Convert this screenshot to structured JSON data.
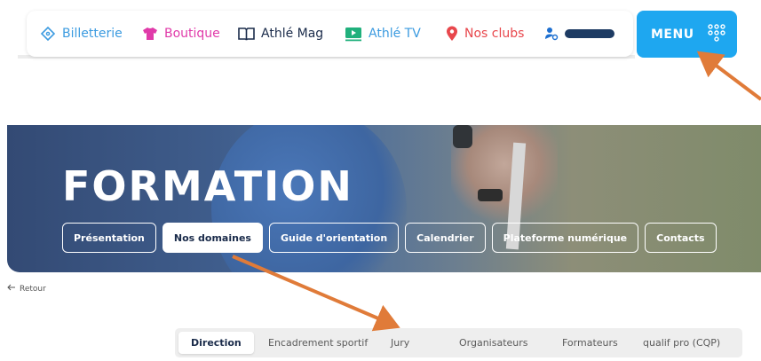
{
  "topbar": {
    "items": [
      {
        "label": "Billetterie",
        "icon": "ticket-icon",
        "color": "#3c9be0"
      },
      {
        "label": "Boutique",
        "icon": "tshirt-icon",
        "color": "#e03aa9"
      },
      {
        "label": "Athlé Mag",
        "icon": "book-icon",
        "color": "#1a2b4a"
      },
      {
        "label": "Athlé TV",
        "icon": "tv-icon",
        "color": "#20b07c"
      },
      {
        "label": "Nos clubs",
        "icon": "map-pin-icon",
        "color": "#e8474c"
      }
    ],
    "user_icon": "user-icon"
  },
  "menu": {
    "label": "MENU",
    "icon": "dots-grid-icon",
    "color": "#1ea7f0"
  },
  "hero": {
    "title": "FORMATION",
    "tabs": [
      {
        "label": "Présentation",
        "active": false
      },
      {
        "label": "Nos domaines",
        "active": true
      },
      {
        "label": "Guide d'orientation",
        "active": false
      },
      {
        "label": "Calendrier",
        "active": false
      },
      {
        "label": "Plateforme numérique",
        "active": false
      },
      {
        "label": "Contacts",
        "active": false
      }
    ]
  },
  "back": {
    "label": "Retour",
    "icon": "arrow-left-icon"
  },
  "subtabs": [
    {
      "label": "Direction",
      "active": true
    },
    {
      "label": "Encadrement sportif",
      "active": false
    },
    {
      "label": "Jury",
      "active": false
    },
    {
      "label": "Organisateurs",
      "active": false
    },
    {
      "label": "Formateurs",
      "active": false
    },
    {
      "label": "qualif pro (CQP)",
      "active": false
    }
  ],
  "annotation_color": "#e07b39"
}
